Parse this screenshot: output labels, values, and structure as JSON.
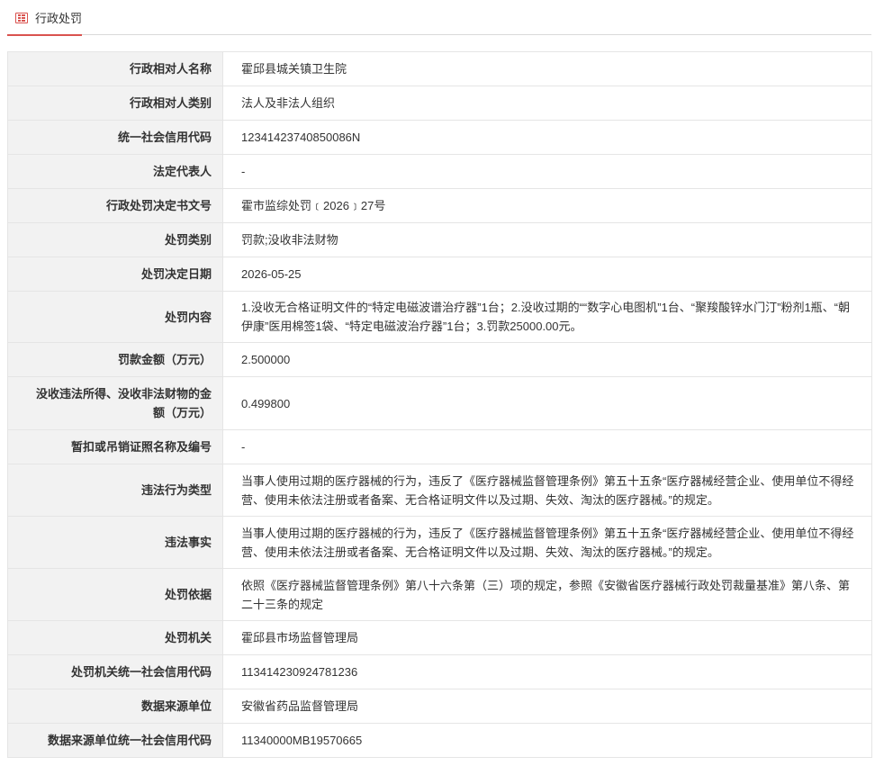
{
  "tab": {
    "label": "行政处罚",
    "icon": "list-icon",
    "accent": "#d9534f"
  },
  "fields": {
    "counterparty_name": {
      "label": "行政相对人名称",
      "value": "霍邱县城关镇卫生院"
    },
    "counterparty_type": {
      "label": "行政相对人类别",
      "value": "法人及非法人组织"
    },
    "credit_code": {
      "label": "统一社会信用代码",
      "value": "12341423740850086N"
    },
    "legal_rep": {
      "label": "法定代表人",
      "value": "-"
    },
    "decision_no": {
      "label": "行政处罚决定书文号",
      "value": "霍市监综处罚﹝2026﹞27号"
    },
    "penalty_type": {
      "label": "处罚类别",
      "value": "罚款;没收非法财物"
    },
    "decision_date": {
      "label": "处罚决定日期",
      "value": "2026-05-25"
    },
    "penalty_content": {
      "label": "处罚内容",
      "value": "1.没收无合格证明文件的“特定电磁波谱治疗器”1台；2.没收过期的““数字心电图机”1台、“聚羧酸锌水门汀”粉剂1瓶、“朝伊康”医用棉签1袋、“特定电磁波治疗器”1台；3.罚款25000.00元。"
    },
    "fine_amount": {
      "label": "罚款金额（万元）",
      "value": "2.500000"
    },
    "confiscated_amount": {
      "label": "没收违法所得、没收非法财物的金额（万元）",
      "value": "0.499800"
    },
    "license_revoked": {
      "label": "暂扣或吊销证照名称及编号",
      "value": "-"
    },
    "violation_type": {
      "label": "违法行为类型",
      "value": "当事人使用过期的医疗器械的行为，违反了《医疗器械监督管理条例》第五十五条“医疗器械经营企业、使用单位不得经营、使用未依法注册或者备案、无合格证明文件以及过期、失效、淘汰的医疗器械。”的规定。"
    },
    "violation_facts": {
      "label": "违法事实",
      "value": "当事人使用过期的医疗器械的行为，违反了《医疗器械监督管理条例》第五十五条“医疗器械经营企业、使用单位不得经营、使用未依法注册或者备案、无合格证明文件以及过期、失效、淘汰的医疗器械。”的规定。"
    },
    "legal_basis": {
      "label": "处罚依据",
      "value": "依照《医疗器械监督管理条例》第八十六条第（三）项的规定，参照《安徽省医疗器械行政处罚裁量基准》第八条、第二十三条的规定"
    },
    "authority": {
      "label": "处罚机关",
      "value": "霍邱县市场监督管理局"
    },
    "authority_credit_code": {
      "label": "处罚机关统一社会信用代码",
      "value": "113414230924781236"
    },
    "data_source": {
      "label": "数据来源单位",
      "value": "安徽省药品监督管理局"
    },
    "data_source_credit_code": {
      "label": "数据来源单位统一社会信用代码",
      "value": "11340000MB19570665"
    }
  }
}
